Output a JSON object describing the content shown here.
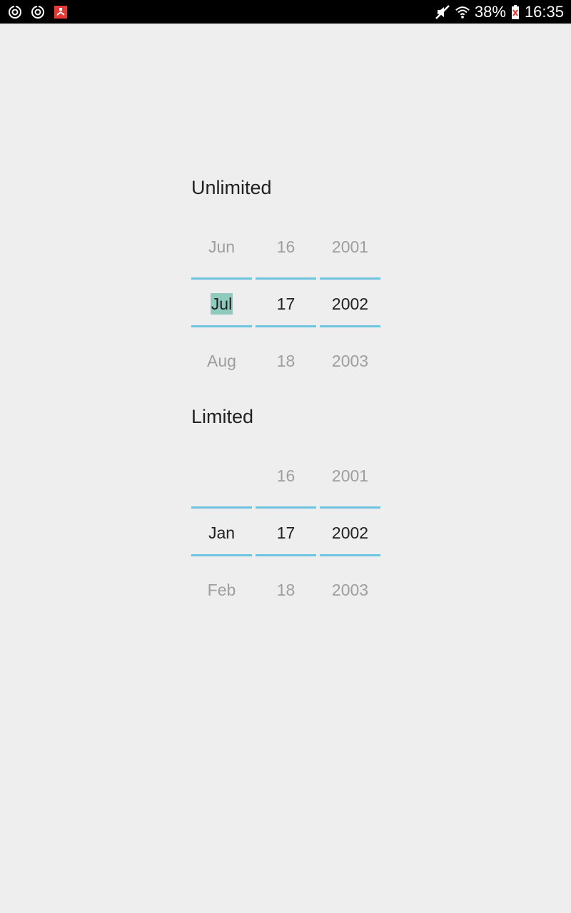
{
  "status_bar": {
    "battery_percent": "38%",
    "time": "16:35",
    "left_icons": [
      "sync-icon",
      "sync-icon",
      "app-notification-icon"
    ],
    "right_icons": [
      "mute-icon",
      "wifi-icon",
      "battery-icon"
    ]
  },
  "unlimited": {
    "title": "Unlimited",
    "month": {
      "prev": "Jun",
      "current": "Jul",
      "next": "Aug"
    },
    "day": {
      "prev": "16",
      "current": "17",
      "next": "18"
    },
    "year": {
      "prev": "2001",
      "current": "2002",
      "next": "2003"
    }
  },
  "limited": {
    "title": "Limited",
    "month": {
      "prev": "",
      "current": "Jan",
      "next": "Feb"
    },
    "day": {
      "prev": "16",
      "current": "17",
      "next": "18"
    },
    "year": {
      "prev": "2001",
      "current": "2002",
      "next": "2003"
    }
  },
  "colors": {
    "background": "#eeeeee",
    "divider": "#6ec3e1",
    "selection_highlight": "#8ecbbe",
    "text_primary": "#212121",
    "text_dim": "#9e9e9e"
  }
}
